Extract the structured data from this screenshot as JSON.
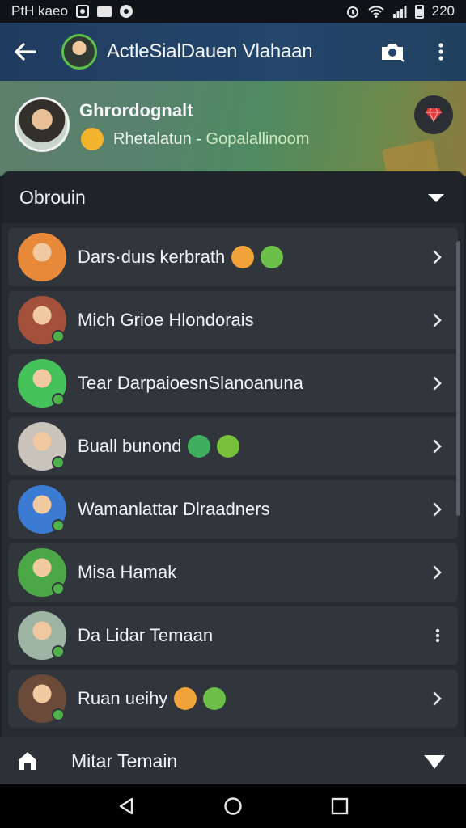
{
  "status_bar": {
    "left_text": "PtH kaeo",
    "time": "220"
  },
  "app_bar": {
    "title": "ActleSialDauen Vlahaan",
    "icons": [
      "back-arrow-icon",
      "camera-icon",
      "more-vert-icon"
    ]
  },
  "profile": {
    "name": "Ghrordognalt",
    "subtitle_main": "Rhetalatun",
    "subtitle_sep": " - ",
    "subtitle_accent": "Gopalallinoom",
    "badge_icon": "ruby-icon"
  },
  "section": {
    "title": "Obrouin",
    "toggle_icon": "caret-down-icon"
  },
  "contacts": [
    {
      "name": "Dars·duıs kerbrath",
      "emojis": [
        "#f2a23a",
        "#6cc04a"
      ],
      "avatar": "#e8893a",
      "action": "chevron"
    },
    {
      "name": "Mich Grioe Hlondorais",
      "emojis": [],
      "avatar": "#a3513b",
      "action": "chevron"
    },
    {
      "name": "Tear DarpaioesnSlanoanuna",
      "emojis": [],
      "avatar": "#45c25a",
      "action": "chevron"
    },
    {
      "name": "Buall bunond",
      "emojis": [
        "#3fae5f",
        "#79c13a"
      ],
      "avatar": "#c9c3bb",
      "action": "chevron"
    },
    {
      "name": "Wamanlattar Dlraadners",
      "emojis": [],
      "avatar": "#3b7bd4",
      "action": "chevron"
    },
    {
      "name": "Misa Hamak",
      "emojis": [],
      "avatar": "#4aa846",
      "action": "chevron"
    },
    {
      "name": "Da Lidar Temaan",
      "emojis": [],
      "avatar": "#9fb5a4",
      "action": "more"
    },
    {
      "name": "Ruan ueihy",
      "emojis": [
        "#f2a23a",
        "#6cc04a"
      ],
      "avatar": "#6c4a3a",
      "action": "chevron"
    }
  ],
  "bottom": {
    "label": "Mitar Temain",
    "icon": "home-icon",
    "fold_icon": "fold-icon"
  },
  "colors": {
    "app_bar": "#24466b",
    "card": "#262a31",
    "row": "#31353c",
    "verified": "#4fb14a"
  }
}
